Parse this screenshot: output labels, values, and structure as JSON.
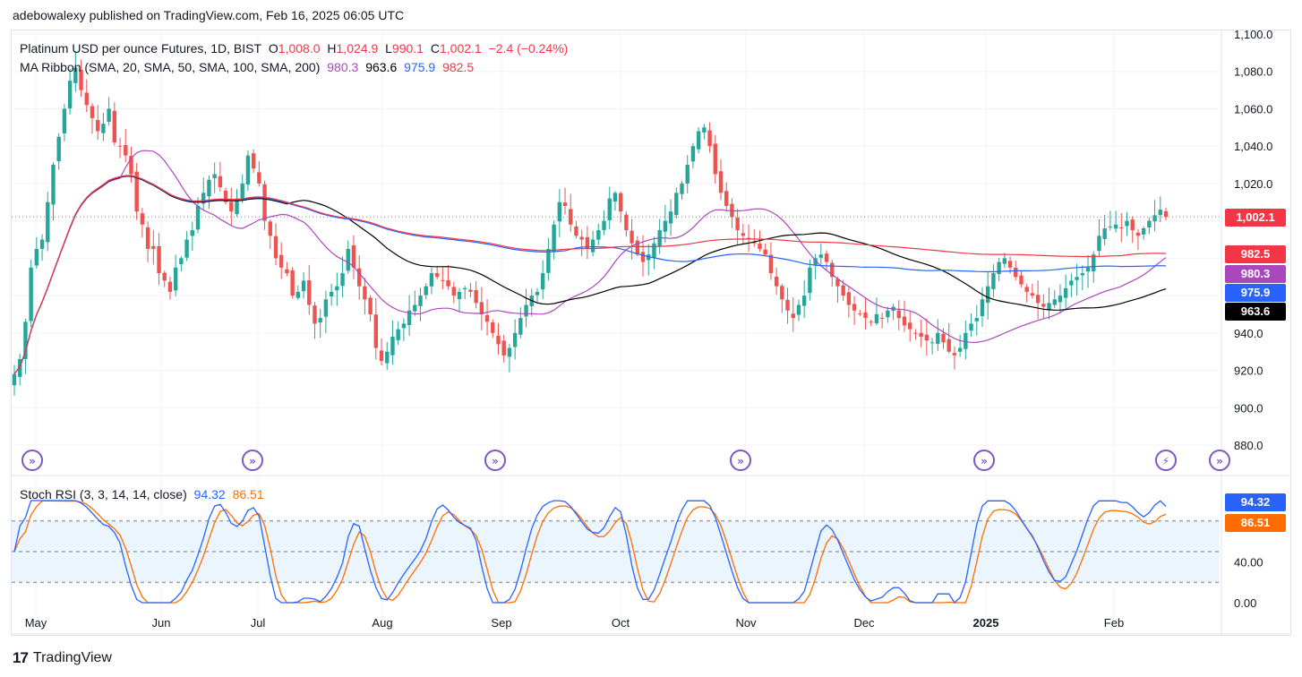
{
  "header": {
    "text": "adebowalexy published on TradingView.com, Feb 16, 2025 06:05 UTC"
  },
  "legend": {
    "symbol": "Platinum USD per ounce Futures, 1D, BIST",
    "o_label": "O",
    "o": "1,008.0",
    "h_label": "H",
    "h": "1,024.9",
    "l_label": "L",
    "l": "990.1",
    "c_label": "C",
    "c": "1,002.1",
    "chg": "−2.4 (−0.24%)",
    "ma_label": "MA Ribbon (SMA, 20, SMA, 50, SMA, 100, SMA, 200)",
    "ma20": "980.3",
    "ma50": "963.6",
    "ma100": "975.9",
    "ma200": "982.5",
    "rsi_label": "Stoch RSI (3, 3, 14, 14, close)",
    "rsi_k": "94.32",
    "rsi_d": "86.51"
  },
  "footer": {
    "brand": "TradingView"
  },
  "colors": {
    "up": "#26a69a",
    "down": "#ef5350",
    "ma20": "#ab47bc",
    "ma50": "#000000",
    "ma100": "#2962ff",
    "ma200": "#f23645",
    "k": "#2962ff",
    "d": "#ff6d00",
    "event": "#7e57c2"
  },
  "chart_data": [
    {
      "type": "candlestick",
      "title": "Platinum USD per ounce Futures, 1D, BIST",
      "ylim": [
        870,
        1102
      ],
      "y_ticks": [
        "1,100.0",
        "1,080.0",
        "1,060.0",
        "1,040.0",
        "1,020.0",
        "1,000.0",
        "980.0",
        "960.0",
        "940.0",
        "920.0",
        "900.0",
        "880.0"
      ],
      "x_labels": [
        "May",
        "Jun",
        "Jul",
        "Aug",
        "Sep",
        "Oct",
        "Nov",
        "Dec",
        "2025",
        "Feb"
      ],
      "last_price": "1,002.1",
      "ma_badges": [
        {
          "name": "SMA 200",
          "value": "982.5",
          "color": "#f23645"
        },
        {
          "name": "SMA 20",
          "value": "980.3",
          "color": "#ab47bc"
        },
        {
          "name": "SMA 100",
          "value": "975.9",
          "color": "#2962ff"
        },
        {
          "name": "SMA 50",
          "value": "963.6",
          "color": "#000000"
        }
      ],
      "closes": [
        918,
        926,
        946,
        975,
        985,
        990,
        1010,
        1030,
        1045,
        1060,
        1075,
        1082,
        1070,
        1062,
        1055,
        1048,
        1052,
        1060,
        1042,
        1040,
        1035,
        1025,
        1005,
        998,
        985,
        985,
        972,
        968,
        962,
        975,
        980,
        990,
        995,
        1008,
        1015,
        1022,
        1025,
        1018,
        1010,
        1005,
        1012,
        1020,
        1035,
        1028,
        1020,
        1000,
        992,
        980,
        975,
        972,
        960,
        962,
        968,
        955,
        945,
        948,
        958,
        962,
        965,
        972,
        985,
        975,
        965,
        958,
        950,
        932,
        925,
        930,
        938,
        942,
        945,
        952,
        955,
        960,
        965,
        972,
        970,
        968,
        965,
        960,
        962,
        964,
        962,
        956,
        950,
        946,
        940,
        934,
        928,
        932,
        940,
        948,
        955,
        960,
        962,
        972,
        985,
        998,
        1010,
        1008,
        998,
        992,
        990,
        985,
        990,
        995,
        1000,
        1012,
        1015,
        1005,
        995,
        988,
        982,
        978,
        982,
        988,
        995,
        1000,
        1005,
        1015,
        1020,
        1030,
        1040,
        1048,
        1050,
        1040,
        1025,
        1015,
        1008,
        1002,
        995,
        992,
        990,
        988,
        985,
        982,
        972,
        965,
        958,
        952,
        948,
        955,
        960,
        975,
        980,
        982,
        978,
        970,
        965,
        960,
        955,
        952,
        950,
        948,
        946,
        950,
        948,
        952,
        954,
        948,
        944,
        942,
        940,
        938,
        936,
        935,
        940,
        935,
        930,
        928,
        932,
        940,
        945,
        948,
        958,
        965,
        972,
        978,
        980,
        975,
        970,
        966,
        962,
        960,
        956,
        954,
        956,
        958,
        960,
        964,
        968,
        970,
        972,
        975,
        982,
        992,
        996,
        997,
        998,
        996,
        1000,
        995,
        992,
        996,
        1000,
        1003,
        1006,
        1002.1
      ],
      "ma20_last": 980.3,
      "ma50_last": 963.6,
      "ma100_last": 975.9,
      "ma200_last": 982.5
    },
    {
      "type": "line",
      "title": "Stoch RSI (3, 3, 14, 14, close)",
      "ylim": [
        0,
        100
      ],
      "y_ticks": [
        "40.00",
        "0.00"
      ],
      "bands": [
        20,
        50,
        80
      ],
      "series": [
        {
          "name": "K",
          "last": 94.32
        },
        {
          "name": "D",
          "last": 86.51
        }
      ]
    }
  ]
}
